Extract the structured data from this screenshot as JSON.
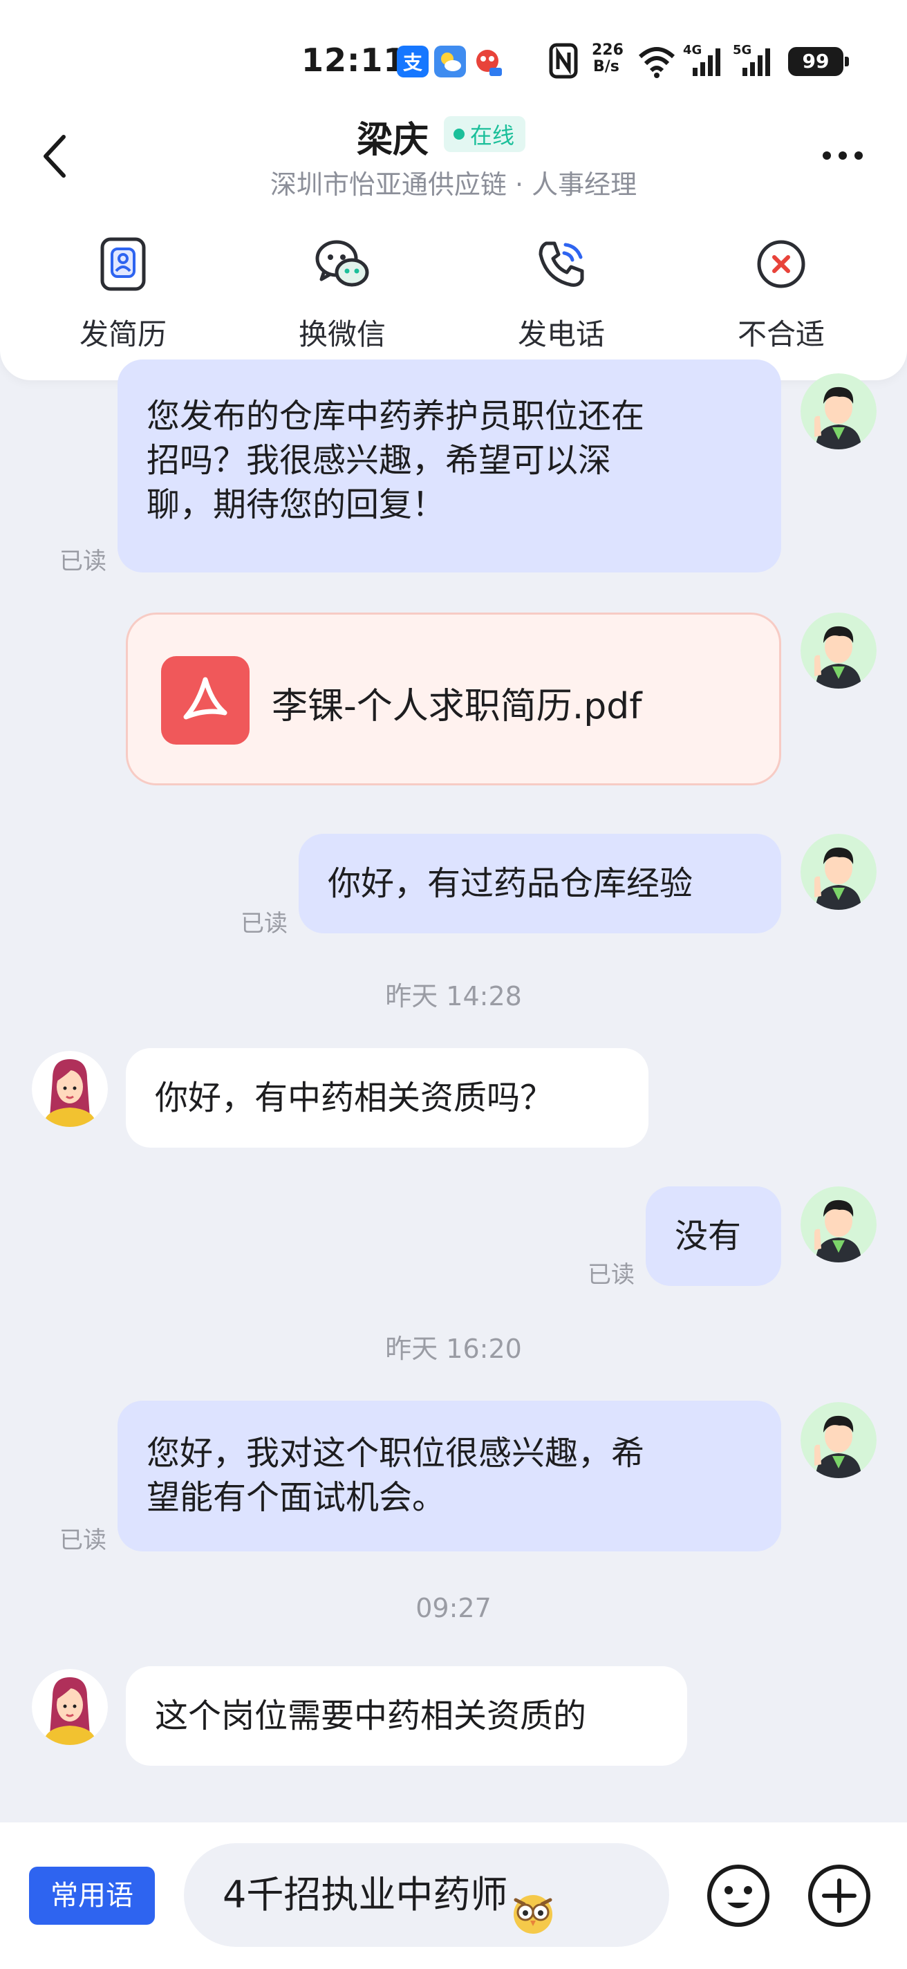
{
  "status_bar": {
    "time": "12:11",
    "app_icons": [
      {
        "name": "alipay-icon",
        "glyph": "支",
        "color": "#1677ff"
      },
      {
        "name": "weather-icon",
        "glyph": "",
        "color": "#3f8cf0"
      },
      {
        "name": "app-notification-icon",
        "glyph": "",
        "color": "#e8433a"
      }
    ],
    "network_speed_value": "226",
    "network_speed_unit": "B/s",
    "signal_4g_label": "4G",
    "signal_5g_label": "5G",
    "battery": "99"
  },
  "header": {
    "contact_name": "梁庆",
    "online_label": "在线",
    "company_role": "深圳市怡亚通供应链 · 人事经理",
    "actions": [
      {
        "label": "发简历",
        "icon": "resume-icon"
      },
      {
        "label": "换微信",
        "icon": "wechat-icon"
      },
      {
        "label": "发电话",
        "icon": "phone-icon"
      },
      {
        "label": "不合适",
        "icon": "reject-icon"
      }
    ]
  },
  "messages": [
    {
      "from": "me",
      "type": "text",
      "lines": [
        "您发布的仓库中药养护员职位还在",
        "招吗？我很感兴趣，希望可以深",
        "聊，期待您的回复！"
      ],
      "status": "已读"
    },
    {
      "from": "me",
      "type": "file",
      "file_name": "李锞-个人求职简历.pdf"
    },
    {
      "from": "me",
      "type": "text",
      "lines": [
        "你好，有过药品仓库经验"
      ],
      "status": "已读"
    },
    {
      "type": "timestamp",
      "text": "昨天 14:28"
    },
    {
      "from": "them",
      "type": "text",
      "lines": [
        "你好，有中药相关资质吗？"
      ]
    },
    {
      "from": "me",
      "type": "text",
      "lines": [
        "没有"
      ],
      "status": "已读"
    },
    {
      "type": "timestamp",
      "text": "昨天 16:20"
    },
    {
      "from": "me",
      "type": "text",
      "lines": [
        "您好，我对这个职位很感兴趣，希",
        "望能有个面试机会。"
      ],
      "status": "已读"
    },
    {
      "type": "timestamp",
      "text": "09:27"
    },
    {
      "from": "them",
      "type": "text",
      "lines": [
        "这个岗位需要中药相关资质的"
      ]
    }
  ],
  "input_bar": {
    "phrases_label": "常用语",
    "draft_text": "4千招执业中药师",
    "draft_emoji": "owl-emoji"
  },
  "colors": {
    "accent": "#2e64f0",
    "online": "#1bbf9a",
    "my_bubble": "#dde3ff",
    "their_bubble": "#ffffff",
    "background": "#eef0f6",
    "pdf_red": "#f0585a"
  }
}
